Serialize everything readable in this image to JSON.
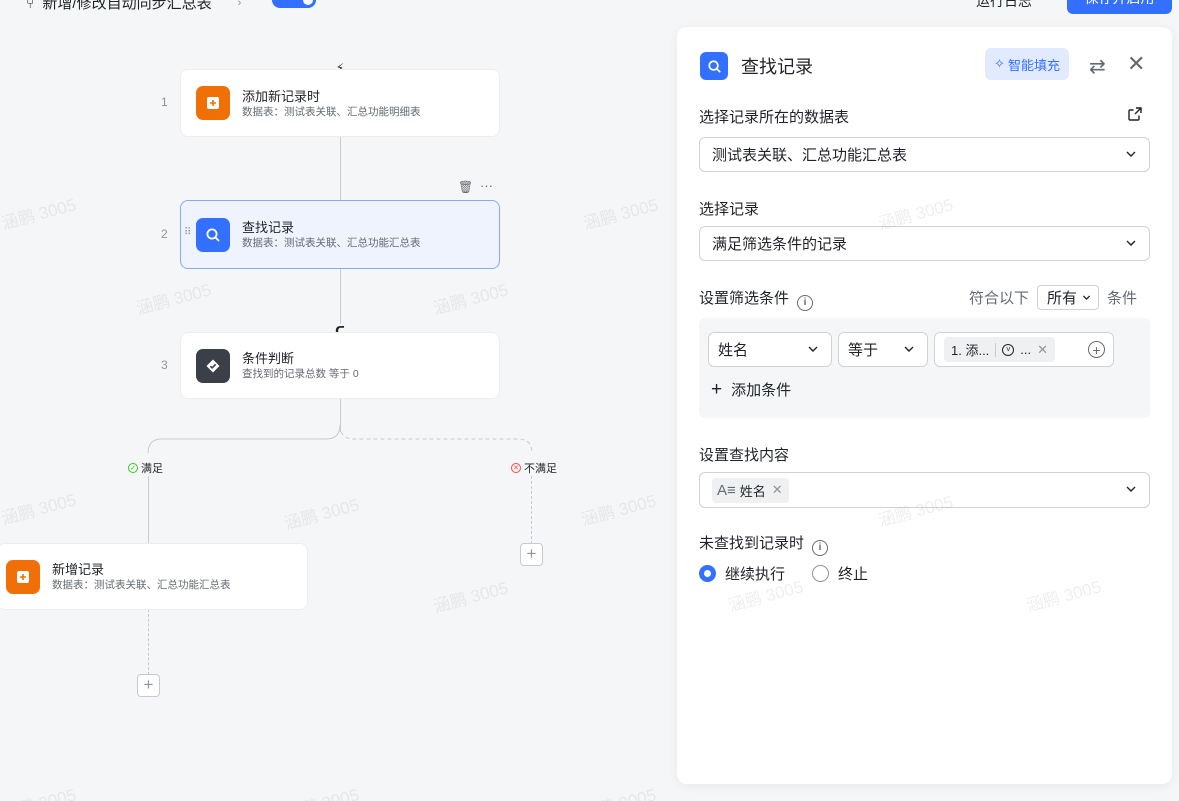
{
  "topbar": {
    "title": "新增/修改自动同步汇总表",
    "run_log": "运行日志",
    "enable_btn": "保存并启用"
  },
  "watermark": "涵鹏 3005",
  "flow": {
    "nodes": [
      {
        "step": "1",
        "title": "添加新记录时",
        "sub": "数据表：测试表关联、汇总功能明细表"
      },
      {
        "step": "2",
        "title": "查找记录",
        "sub": "数据表：测试表关联、汇总功能汇总表"
      },
      {
        "step": "3",
        "title": "条件判断",
        "sub": "查找到的记录总数 等于 0"
      }
    ],
    "branch_yes": "满足",
    "branch_no": "不满足",
    "new_record": {
      "title": "新增记录",
      "sub": "数据表：测试表关联、汇总功能汇总表"
    },
    "add_symbol": "+"
  },
  "panel": {
    "title": "查找记录",
    "smart_fill": "智能填充",
    "table_label": "选择记录所在的数据表",
    "table_value": "测试表关联、汇总功能汇总表",
    "record_label": "选择记录",
    "record_value": "满足筛选条件的记录",
    "filter_label": "设置筛选条件",
    "match_prefix": "符合以下",
    "match_value": "所有",
    "match_suffix": "条件",
    "condition": {
      "field": "姓名",
      "operator": "等于",
      "value_tag": "1. 添...",
      "value_tag2": "..."
    },
    "add_condition": "添加条件",
    "content_label": "设置查找内容",
    "content_tag": "姓名",
    "notfound_label": "未查找到记录时",
    "options": [
      "继续执行",
      "终止"
    ],
    "selected_option": "继续执行"
  },
  "colors": {
    "accent": "#3370ff",
    "orange": "#f07007",
    "dark": "#3b3f47",
    "success": "#34c724",
    "danger": "#f54a45"
  }
}
